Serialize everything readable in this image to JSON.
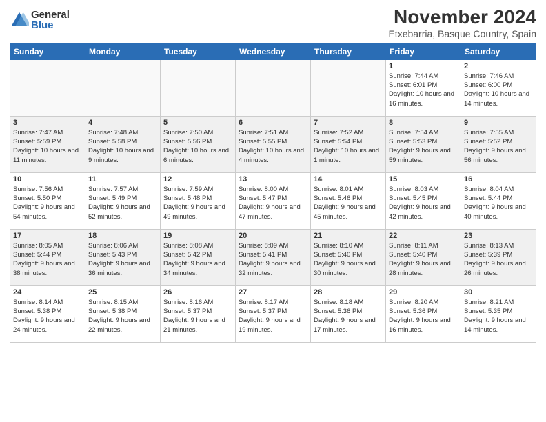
{
  "header": {
    "logo_general": "General",
    "logo_blue": "Blue",
    "month_title": "November 2024",
    "location": "Etxebarria, Basque Country, Spain"
  },
  "days_of_week": [
    "Sunday",
    "Monday",
    "Tuesday",
    "Wednesday",
    "Thursday",
    "Friday",
    "Saturday"
  ],
  "weeks": [
    [
      {
        "day": "",
        "empty": true
      },
      {
        "day": "",
        "empty": true
      },
      {
        "day": "",
        "empty": true
      },
      {
        "day": "",
        "empty": true
      },
      {
        "day": "",
        "empty": true
      },
      {
        "day": "1",
        "sunrise": "7:44 AM",
        "sunset": "6:01 PM",
        "daylight": "10 hours and 16 minutes."
      },
      {
        "day": "2",
        "sunrise": "7:46 AM",
        "sunset": "6:00 PM",
        "daylight": "10 hours and 14 minutes."
      }
    ],
    [
      {
        "day": "3",
        "sunrise": "7:47 AM",
        "sunset": "5:59 PM",
        "daylight": "10 hours and 11 minutes.",
        "shaded": true
      },
      {
        "day": "4",
        "sunrise": "7:48 AM",
        "sunset": "5:58 PM",
        "daylight": "10 hours and 9 minutes.",
        "shaded": true
      },
      {
        "day": "5",
        "sunrise": "7:50 AM",
        "sunset": "5:56 PM",
        "daylight": "10 hours and 6 minutes.",
        "shaded": true
      },
      {
        "day": "6",
        "sunrise": "7:51 AM",
        "sunset": "5:55 PM",
        "daylight": "10 hours and 4 minutes.",
        "shaded": true
      },
      {
        "day": "7",
        "sunrise": "7:52 AM",
        "sunset": "5:54 PM",
        "daylight": "10 hours and 1 minute.",
        "shaded": true
      },
      {
        "day": "8",
        "sunrise": "7:54 AM",
        "sunset": "5:53 PM",
        "daylight": "9 hours and 59 minutes.",
        "shaded": true
      },
      {
        "day": "9",
        "sunrise": "7:55 AM",
        "sunset": "5:52 PM",
        "daylight": "9 hours and 56 minutes.",
        "shaded": true
      }
    ],
    [
      {
        "day": "10",
        "sunrise": "7:56 AM",
        "sunset": "5:50 PM",
        "daylight": "9 hours and 54 minutes."
      },
      {
        "day": "11",
        "sunrise": "7:57 AM",
        "sunset": "5:49 PM",
        "daylight": "9 hours and 52 minutes."
      },
      {
        "day": "12",
        "sunrise": "7:59 AM",
        "sunset": "5:48 PM",
        "daylight": "9 hours and 49 minutes."
      },
      {
        "day": "13",
        "sunrise": "8:00 AM",
        "sunset": "5:47 PM",
        "daylight": "9 hours and 47 minutes."
      },
      {
        "day": "14",
        "sunrise": "8:01 AM",
        "sunset": "5:46 PM",
        "daylight": "9 hours and 45 minutes."
      },
      {
        "day": "15",
        "sunrise": "8:03 AM",
        "sunset": "5:45 PM",
        "daylight": "9 hours and 42 minutes."
      },
      {
        "day": "16",
        "sunrise": "8:04 AM",
        "sunset": "5:44 PM",
        "daylight": "9 hours and 40 minutes."
      }
    ],
    [
      {
        "day": "17",
        "sunrise": "8:05 AM",
        "sunset": "5:44 PM",
        "daylight": "9 hours and 38 minutes.",
        "shaded": true
      },
      {
        "day": "18",
        "sunrise": "8:06 AM",
        "sunset": "5:43 PM",
        "daylight": "9 hours and 36 minutes.",
        "shaded": true
      },
      {
        "day": "19",
        "sunrise": "8:08 AM",
        "sunset": "5:42 PM",
        "daylight": "9 hours and 34 minutes.",
        "shaded": true
      },
      {
        "day": "20",
        "sunrise": "8:09 AM",
        "sunset": "5:41 PM",
        "daylight": "9 hours and 32 minutes.",
        "shaded": true
      },
      {
        "day": "21",
        "sunrise": "8:10 AM",
        "sunset": "5:40 PM",
        "daylight": "9 hours and 30 minutes.",
        "shaded": true
      },
      {
        "day": "22",
        "sunrise": "8:11 AM",
        "sunset": "5:40 PM",
        "daylight": "9 hours and 28 minutes.",
        "shaded": true
      },
      {
        "day": "23",
        "sunrise": "8:13 AM",
        "sunset": "5:39 PM",
        "daylight": "9 hours and 26 minutes.",
        "shaded": true
      }
    ],
    [
      {
        "day": "24",
        "sunrise": "8:14 AM",
        "sunset": "5:38 PM",
        "daylight": "9 hours and 24 minutes."
      },
      {
        "day": "25",
        "sunrise": "8:15 AM",
        "sunset": "5:38 PM",
        "daylight": "9 hours and 22 minutes."
      },
      {
        "day": "26",
        "sunrise": "8:16 AM",
        "sunset": "5:37 PM",
        "daylight": "9 hours and 21 minutes."
      },
      {
        "day": "27",
        "sunrise": "8:17 AM",
        "sunset": "5:37 PM",
        "daylight": "9 hours and 19 minutes."
      },
      {
        "day": "28",
        "sunrise": "8:18 AM",
        "sunset": "5:36 PM",
        "daylight": "9 hours and 17 minutes."
      },
      {
        "day": "29",
        "sunrise": "8:20 AM",
        "sunset": "5:36 PM",
        "daylight": "9 hours and 16 minutes."
      },
      {
        "day": "30",
        "sunrise": "8:21 AM",
        "sunset": "5:35 PM",
        "daylight": "9 hours and 14 minutes."
      }
    ]
  ]
}
